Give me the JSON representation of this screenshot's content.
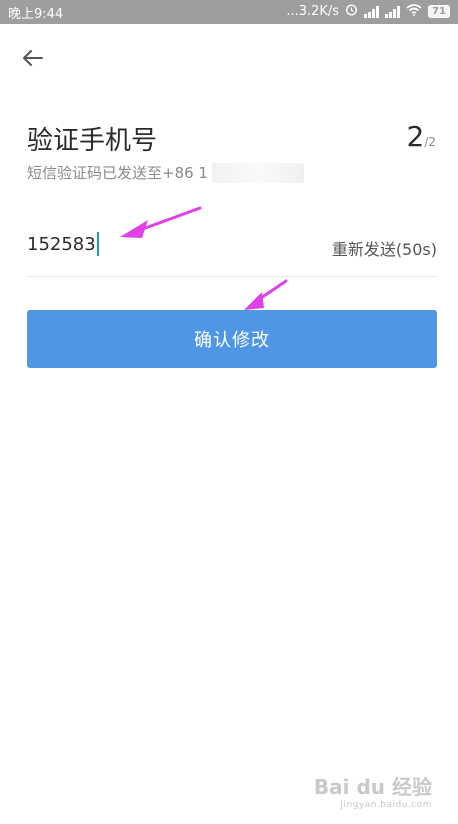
{
  "status_bar": {
    "time": "晚上9:44",
    "network_speed": "...3.2K/s",
    "battery": "71",
    "icons": [
      "alarm-icon",
      "signal-icon",
      "signal-icon",
      "wifi-icon",
      "battery-icon"
    ]
  },
  "header": {
    "back_icon": "back-arrow-icon"
  },
  "main": {
    "title": "验证手机号",
    "step_current": "2",
    "step_total": "/2",
    "subtitle": "短信验证码已发送至+86 1"
  },
  "code_field": {
    "value": "152583",
    "resend_label": "重新发送(50s)"
  },
  "confirm_button": {
    "label": "确认修改"
  },
  "watermark": {
    "brand": "Bai du 经验",
    "url": "jingyan.baidu.com"
  },
  "colors": {
    "accent": "#4f97e6",
    "annotation": "#e040e8",
    "caret": "#1aa4a0"
  }
}
